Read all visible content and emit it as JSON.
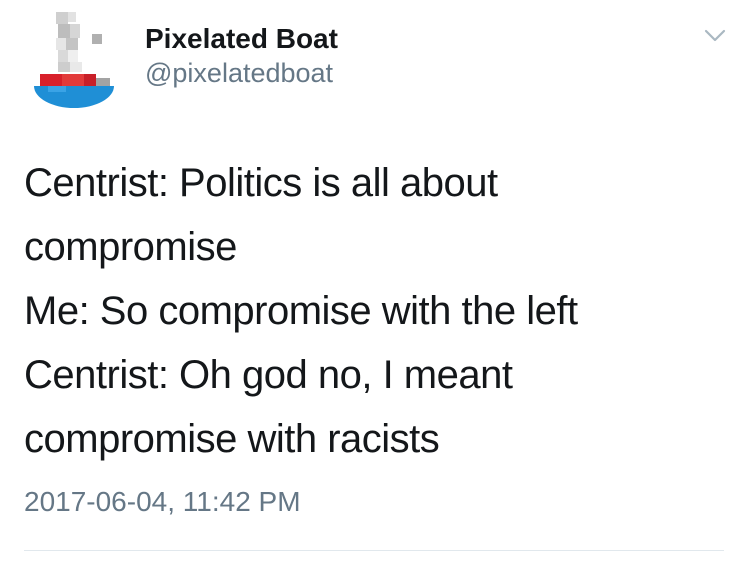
{
  "user": {
    "display_name": "Pixelated Boat",
    "handle": "@pixelatedboat",
    "avatar_icon": "pixelated-boat-avatar-icon"
  },
  "tweet": {
    "lines": [
      "Centrist: Politics is all about",
      "compromise",
      "Me: So compromise with the left",
      "Centrist: Oh god no, I meant",
      "compromise with racists"
    ],
    "timestamp": "2017-06-04, 11:42 PM"
  },
  "menu": {
    "icon": "chevron-down-icon"
  },
  "colors": {
    "name": "#14171a",
    "secondary": "#657786",
    "divider": "#e1e8ed",
    "avatar_red": "#d8202a",
    "avatar_blue": "#1f8fd6"
  }
}
